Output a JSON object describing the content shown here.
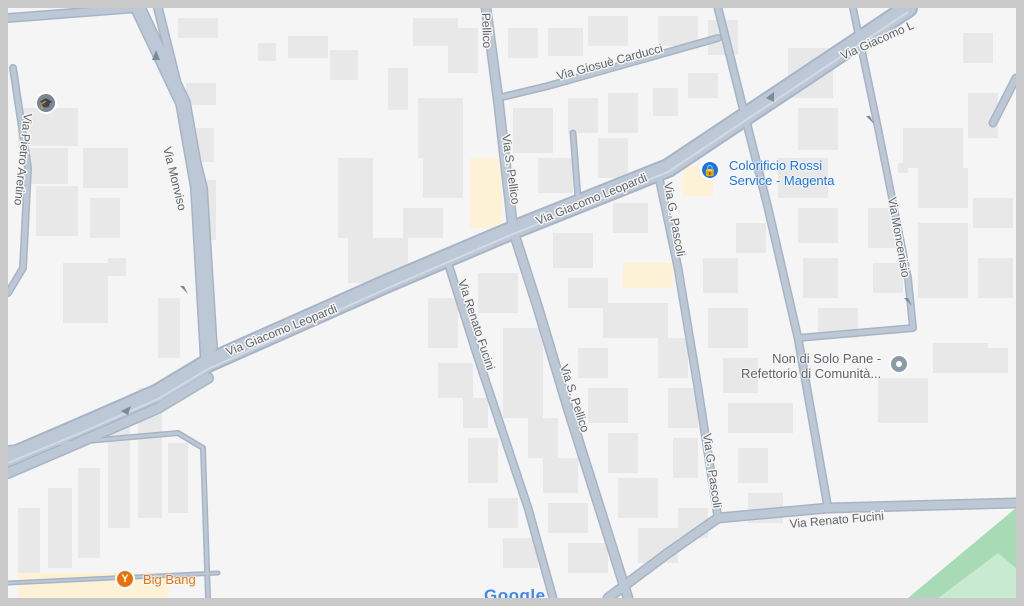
{
  "colors": {
    "background": "#f5f5f5",
    "building": "#e8e8e8",
    "road": "#b9c5d3",
    "road_edge": "#a7b4c4",
    "school_pin": "#7b8794",
    "shop_pin": "#1a73e8",
    "bar_pin": "#e8710a",
    "place_pin": "#8a9ba8",
    "park": "#a8dab5",
    "highlight_block": "#fdf2d6"
  },
  "streets": {
    "via_giacomo_leopardi_west": "Via Giacomo Leopardi",
    "via_giacomo_leopardi_mid": "Via Giacomo Leopardi",
    "via_giacomo_leopardi_east": "Via Giacomo L",
    "via_giosue_carducci": "Via Giosuè Carducci",
    "via_monviso": "Via Monviso",
    "via_pietro_aretino": "Via Pietro Aretino",
    "via_s_pellico_north": "Via S. Pellico",
    "via_s_pellico_south": "Via S. Pellico",
    "via_s_pellico_top": "Pellico",
    "via_renato_fucini_west": "Via Renato Fucini",
    "via_renato_fucini_south": "Via Renato Fucini",
    "via_g_pascoli_north": "Via G. Pascoli",
    "via_g_pascoli_south": "Via G. Pascoli",
    "via_moncenisio": "Via Moncenisio"
  },
  "places": {
    "colorificio": {
      "line1": "Colorificio Rossi",
      "line2": "Service - Magenta",
      "icon": "shopping-bag-icon"
    },
    "non_di_solo_pane": {
      "line1": "Non di Solo Pane -",
      "line2": "Refettorio di Comunità...",
      "icon": "place-marker-icon"
    },
    "big_bang": {
      "name": "Big Bang",
      "icon": "cocktail-icon"
    },
    "school": {
      "icon": "school-icon"
    }
  },
  "attribution": {
    "logo_text": "Google"
  }
}
